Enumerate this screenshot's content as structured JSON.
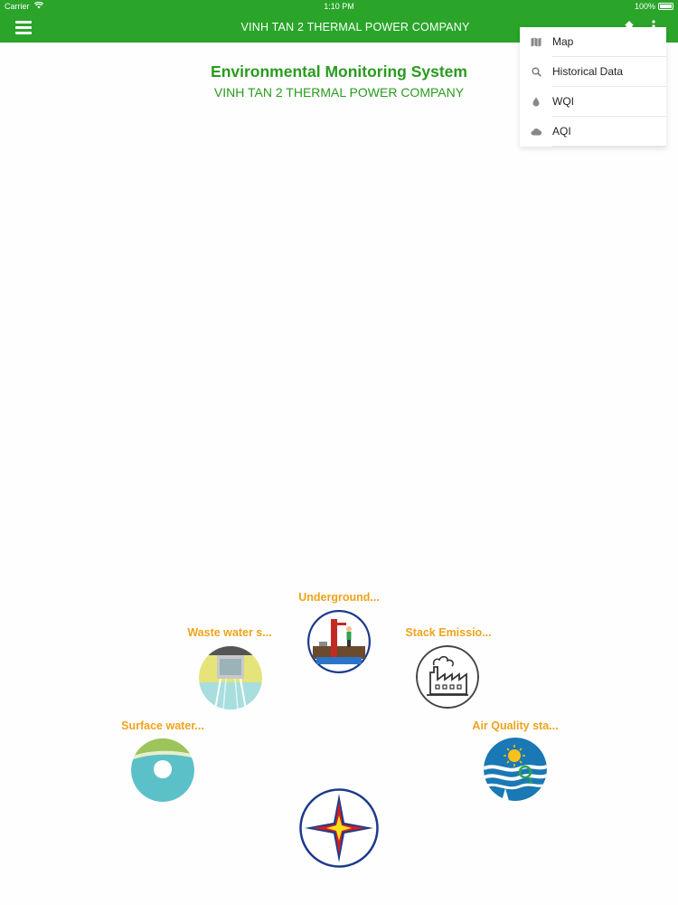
{
  "status_bar": {
    "carrier": "Carrier",
    "time": "1:10 PM",
    "battery": "100%"
  },
  "navbar": {
    "title": "VINH TAN 2 THERMAL POWER COMPANY",
    "menu_icon": "hamburger-icon",
    "right_icons": [
      "home-icon",
      "more-vertical-icon"
    ]
  },
  "header": {
    "title": "Environmental Monitoring System",
    "subtitle": "VINH TAN 2 THERMAL POWER COMPANY"
  },
  "menu": {
    "items": [
      {
        "label": "Map",
        "icon": "map-icon"
      },
      {
        "label": "Historical Data",
        "icon": "search-icon"
      },
      {
        "label": "WQI",
        "icon": "water-drop-icon"
      },
      {
        "label": "AQI",
        "icon": "cloud-icon"
      }
    ]
  },
  "stations": [
    {
      "label": "Underground...",
      "icon": "underground-water-icon"
    },
    {
      "label": "Waste water s...",
      "icon": "waste-water-icon"
    },
    {
      "label": "Stack Emissio...",
      "icon": "factory-stack-icon"
    },
    {
      "label": "Surface water...",
      "icon": "surface-water-icon"
    },
    {
      "label": "Air Quality sta...",
      "icon": "air-quality-icon"
    }
  ],
  "center_logo": "compass-star-logo",
  "colors": {
    "primary_green": "#2aa52a",
    "title_green": "#2a9b1f",
    "label_orange": "#f0a31c",
    "logo_blue": "#1c3a8c",
    "logo_red": "#d02020",
    "logo_yellow": "#f6e21a"
  }
}
